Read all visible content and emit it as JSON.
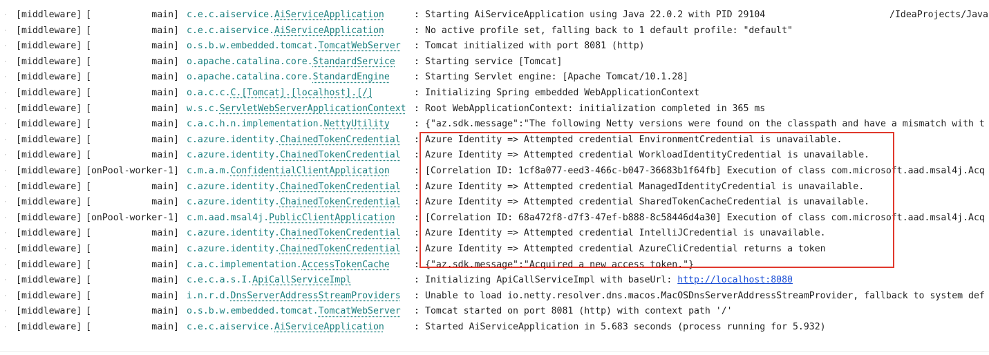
{
  "console": {
    "highlight_color": "#e0382c",
    "category_color": "#1a7f7f",
    "link_color": "#1b4fd6",
    "lines": [
      {
        "module": "[middleware]",
        "thread": "[           main]",
        "cat_pkg": "c.e.c.aiservice.",
        "cat_cls": "AiServiceApplication",
        "sep": ":",
        "msg": "Starting AiServiceApplication using Java 22.0.2 with PID 29104",
        "msg_link": "",
        "msg_tail": "",
        "extra": "/IdeaProjects/Java"
      },
      {
        "module": "[middleware]",
        "thread": "[           main]",
        "cat_pkg": "c.e.c.aiservice.",
        "cat_cls": "AiServiceApplication",
        "sep": ":",
        "msg": "No active profile set, falling back to 1 default profile: \"default\"",
        "msg_link": "",
        "msg_tail": "",
        "extra": ""
      },
      {
        "module": "[middleware]",
        "thread": "[           main]",
        "cat_pkg": "o.s.b.w.embedded.tomcat.",
        "cat_cls": "TomcatWebServer",
        "sep": ":",
        "msg": "Tomcat initialized with port 8081 (http)",
        "msg_link": "",
        "msg_tail": "",
        "extra": ""
      },
      {
        "module": "[middleware]",
        "thread": "[           main]",
        "cat_pkg": "o.apache.catalina.core.",
        "cat_cls": "StandardService",
        "sep": ":",
        "msg": "Starting service [Tomcat]",
        "msg_link": "",
        "msg_tail": "",
        "extra": ""
      },
      {
        "module": "[middleware]",
        "thread": "[           main]",
        "cat_pkg": "o.apache.catalina.core.",
        "cat_cls": "StandardEngine",
        "sep": ":",
        "msg": "Starting Servlet engine: [Apache Tomcat/10.1.28]",
        "msg_link": "",
        "msg_tail": "",
        "extra": ""
      },
      {
        "module": "[middleware]",
        "thread": "[           main]",
        "cat_pkg": "o.a.c.c.",
        "cat_cls": "C.[Tomcat].[localhost].[/]",
        "sep": ":",
        "msg": "Initializing Spring embedded WebApplicationContext",
        "msg_link": "",
        "msg_tail": "",
        "extra": ""
      },
      {
        "module": "[middleware]",
        "thread": "[           main]",
        "cat_pkg": "w.s.c.",
        "cat_cls": "ServletWebServerApplicationContext",
        "sep": ":",
        "msg": "Root WebApplicationContext: initialization completed in 365 ms",
        "msg_link": "",
        "msg_tail": "",
        "extra": ""
      },
      {
        "module": "[middleware]",
        "thread": "[           main]",
        "cat_pkg": "c.a.c.h.n.implementation.",
        "cat_cls": "NettyUtility",
        "sep": ":",
        "msg": "{\"az.sdk.message\":\"The following Netty versions were found on the classpath and have a mismatch with t",
        "msg_link": "",
        "msg_tail": "",
        "extra": ""
      },
      {
        "module": "[middleware]",
        "thread": "[           main]",
        "cat_pkg": "c.azure.identity.",
        "cat_cls": "ChainedTokenCredential",
        "sep": ":",
        "msg": "Azure Identity => Attempted credential EnvironmentCredential is unavailable.",
        "msg_link": "",
        "msg_tail": "",
        "extra": ""
      },
      {
        "module": "[middleware]",
        "thread": "[           main]",
        "cat_pkg": "c.azure.identity.",
        "cat_cls": "ChainedTokenCredential",
        "sep": ":",
        "msg": "Azure Identity => Attempted credential WorkloadIdentityCredential is unavailable.",
        "msg_link": "",
        "msg_tail": "",
        "extra": ""
      },
      {
        "module": "[middleware]",
        "thread": "[onPool-worker-1]",
        "cat_pkg": "c.m.a.m.",
        "cat_cls": "ConfidentialClientApplication",
        "sep": ":",
        "msg": "[Correlation ID: 1cf8a077-eed3-466c-b047-36683b1f64fb] Execution of class com.microsoft.aad.msal4j.Acq",
        "msg_link": "",
        "msg_tail": "",
        "extra": ""
      },
      {
        "module": "[middleware]",
        "thread": "[           main]",
        "cat_pkg": "c.azure.identity.",
        "cat_cls": "ChainedTokenCredential",
        "sep": ":",
        "msg": "Azure Identity => Attempted credential ManagedIdentityCredential is unavailable.",
        "msg_link": "",
        "msg_tail": "",
        "extra": ""
      },
      {
        "module": "[middleware]",
        "thread": "[           main]",
        "cat_pkg": "c.azure.identity.",
        "cat_cls": "ChainedTokenCredential",
        "sep": ":",
        "msg": "Azure Identity => Attempted credential SharedTokenCacheCredential is unavailable.",
        "msg_link": "",
        "msg_tail": "",
        "extra": ""
      },
      {
        "module": "[middleware]",
        "thread": "[onPool-worker-1]",
        "cat_pkg": "c.m.aad.msal4j.",
        "cat_cls": "PublicClientApplication",
        "sep": ":",
        "msg": "[Correlation ID: 68a472f8-d7f3-47ef-b888-8c58446d4a30] Execution of class com.microsoft.aad.msal4j.Acq",
        "msg_link": "",
        "msg_tail": "",
        "extra": ""
      },
      {
        "module": "[middleware]",
        "thread": "[           main]",
        "cat_pkg": "c.azure.identity.",
        "cat_cls": "ChainedTokenCredential",
        "sep": ":",
        "msg": "Azure Identity => Attempted credential IntelliJCredential is unavailable.",
        "msg_link": "",
        "msg_tail": "",
        "extra": ""
      },
      {
        "module": "[middleware]",
        "thread": "[           main]",
        "cat_pkg": "c.azure.identity.",
        "cat_cls": "ChainedTokenCredential",
        "sep": ":",
        "msg": "Azure Identity => Attempted credential AzureCliCredential returns a token",
        "msg_link": "",
        "msg_tail": "",
        "extra": ""
      },
      {
        "module": "[middleware]",
        "thread": "[           main]",
        "cat_pkg": "c.a.c.implementation.",
        "cat_cls": "AccessTokenCache",
        "sep": ":",
        "msg": "{\"az.sdk.message\":\"Acquired a new access token.\"}",
        "msg_link": "",
        "msg_tail": "",
        "extra": ""
      },
      {
        "module": "[middleware]",
        "thread": "[           main]",
        "cat_pkg": "c.e.c.a.s.I.",
        "cat_cls": "ApiCallServiceImpl",
        "sep": ":",
        "msg": "Initializing ApiCallServiceImpl with baseUrl: ",
        "msg_link": "http://localhost:8080",
        "msg_tail": "",
        "extra": ""
      },
      {
        "module": "[middleware]",
        "thread": "[           main]",
        "cat_pkg": "i.n.r.d.",
        "cat_cls": "DnsServerAddressStreamProviders",
        "sep": ":",
        "msg": "Unable to load io.netty.resolver.dns.macos.MacOSDnsServerAddressStreamProvider, fallback to system def",
        "msg_link": "",
        "msg_tail": "",
        "extra": ""
      },
      {
        "module": "[middleware]",
        "thread": "[           main]",
        "cat_pkg": "o.s.b.w.embedded.tomcat.",
        "cat_cls": "TomcatWebServer",
        "sep": ":",
        "msg": "Tomcat started on port 8081 (http) with context path '/'",
        "msg_link": "",
        "msg_tail": "",
        "extra": ""
      },
      {
        "module": "[middleware]",
        "thread": "[           main]",
        "cat_pkg": "c.e.c.aiservice.",
        "cat_cls": "AiServiceApplication",
        "sep": ":",
        "msg": "Started AiServiceApplication in 5.683 seconds (process running for 5.932)",
        "msg_link": "",
        "msg_tail": "",
        "extra": ""
      }
    ]
  }
}
